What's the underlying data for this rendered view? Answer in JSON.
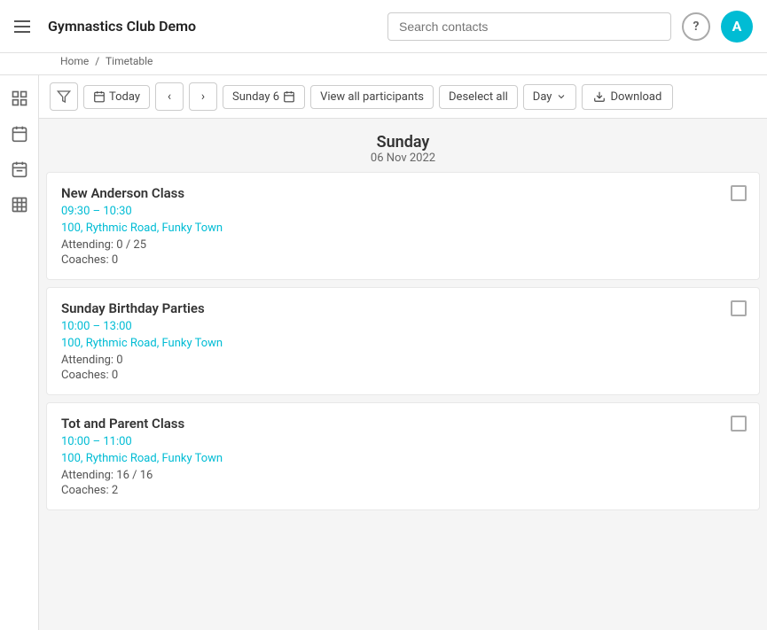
{
  "app": {
    "title": "Gymnastics Club Demo",
    "logo_initial": "A"
  },
  "header": {
    "search_placeholder": "Search contacts",
    "help_label": "?",
    "breadcrumbs": [
      {
        "label": "Home",
        "href": "#"
      },
      {
        "label": "Timetable",
        "href": "#"
      }
    ]
  },
  "sidebar": {
    "items": [
      {
        "name": "menu-icon",
        "icon": "menu"
      },
      {
        "name": "event-icon",
        "icon": "event"
      },
      {
        "name": "calendar-icon",
        "icon": "calendar"
      },
      {
        "name": "grid-icon",
        "icon": "grid"
      }
    ]
  },
  "toolbar": {
    "filter_label": "",
    "today_label": "Today",
    "prev_label": "‹",
    "next_label": "›",
    "date_label": "Sunday 6",
    "view_all_label": "View all participants",
    "deselect_label": "Deselect all",
    "view_mode_label": "Day",
    "download_label": "Download"
  },
  "day": {
    "name": "Sunday",
    "date": "06 Nov 2022"
  },
  "events": [
    {
      "title": "New Anderson Class",
      "time": "09:30 – 10:30",
      "location": "100, Rythmic Road, Funky Town",
      "attending": "Attending: 0 / 25",
      "coaches": "Coaches: 0"
    },
    {
      "title": "Sunday Birthday Parties",
      "time": "10:00 – 13:00",
      "location": "100, Rythmic Road, Funky Town",
      "attending": "Attending: 0",
      "coaches": "Coaches: 0"
    },
    {
      "title": "Tot and Parent Class",
      "time": "10:00 – 11:00",
      "location": "100, Rythmic Road, Funky Town",
      "attending": "Attending: 16 / 16",
      "coaches": "Coaches: 2"
    }
  ]
}
